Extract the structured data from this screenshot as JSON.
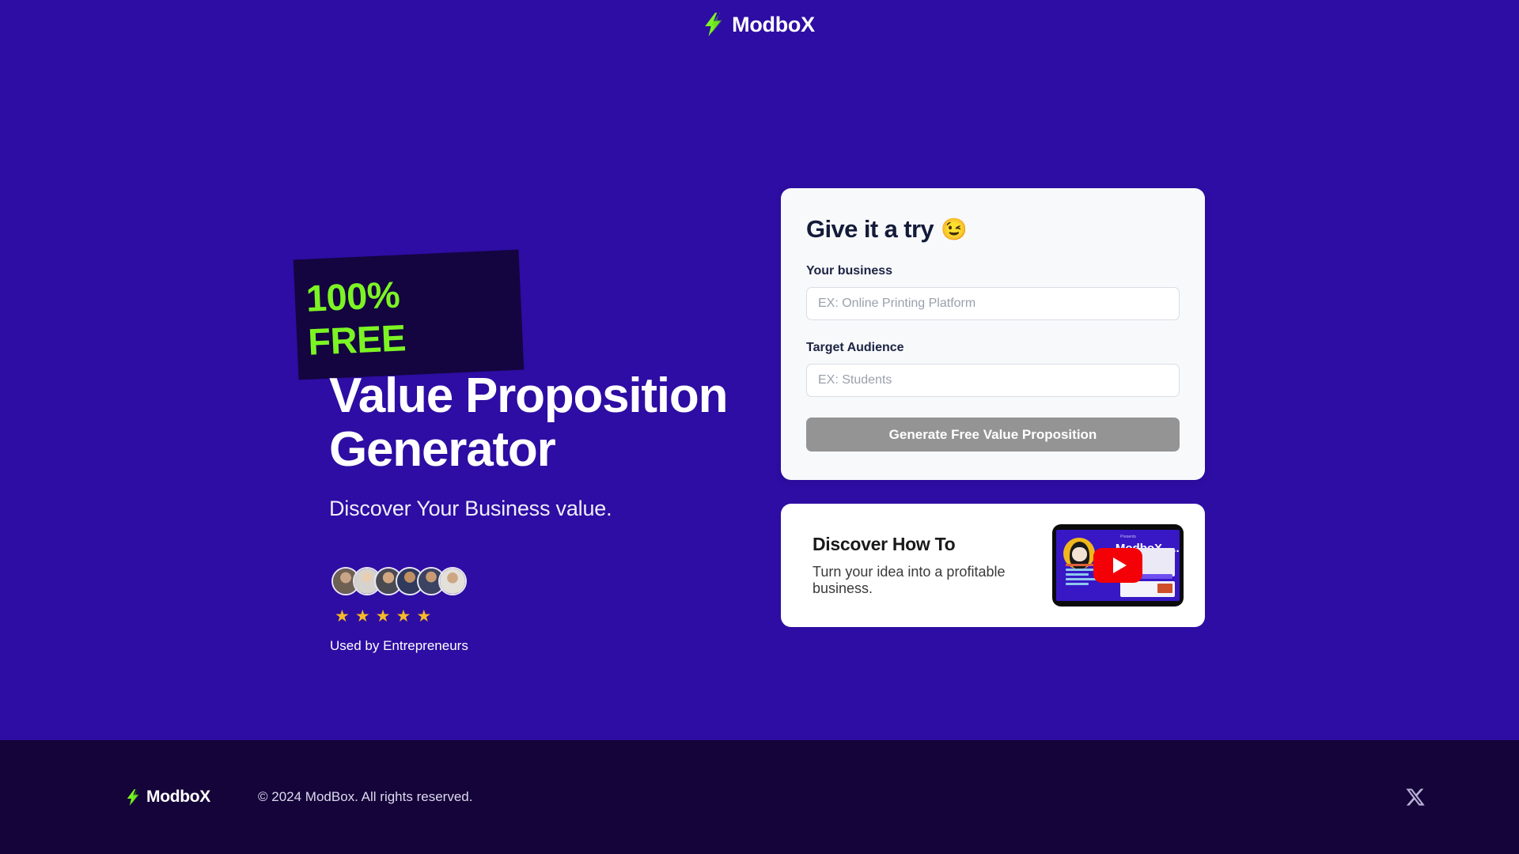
{
  "header": {
    "logo_icon": "lightning-bolt-icon",
    "brand_name": "ModboX"
  },
  "hero": {
    "badge": {
      "line1": "100%",
      "line2": "FREE"
    },
    "title": "Value Proposition Generator",
    "subtitle": "Discover Your Business value.",
    "social_proof": {
      "avatar_count": 6,
      "stars": 5,
      "star_glyph": "★",
      "label": "Used by Entrepreneurs"
    }
  },
  "form_card": {
    "title": "Give it a try",
    "title_emoji": "😉",
    "fields": [
      {
        "label": "Your business",
        "placeholder": "EX: Online Printing Platform",
        "value": ""
      },
      {
        "label": "Target Audience",
        "placeholder": "EX: Students",
        "value": ""
      }
    ],
    "submit_label": "Generate Free Value Proposition"
  },
  "video_card": {
    "title": "Discover How To",
    "description": "Turn your idea into a profitable business.",
    "thumbnail": {
      "kicker": "Presents",
      "overlay_title": "ModboX -...",
      "play_icon": "youtube-play-icon"
    }
  },
  "footer": {
    "logo_icon": "lightning-bolt-icon",
    "brand_name": "ModboX",
    "copyright": "© 2024 ModBox. All rights reserved.",
    "social_icon": "x-twitter-icon"
  },
  "colors": {
    "background": "#2d0da3",
    "footer_background": "#140439",
    "accent_green": "#7cf424",
    "badge_background": "#140440",
    "card_background": "#f8f9fb",
    "button_disabled": "#949494",
    "star": "#f7b928",
    "youtube_red": "#f40007"
  }
}
